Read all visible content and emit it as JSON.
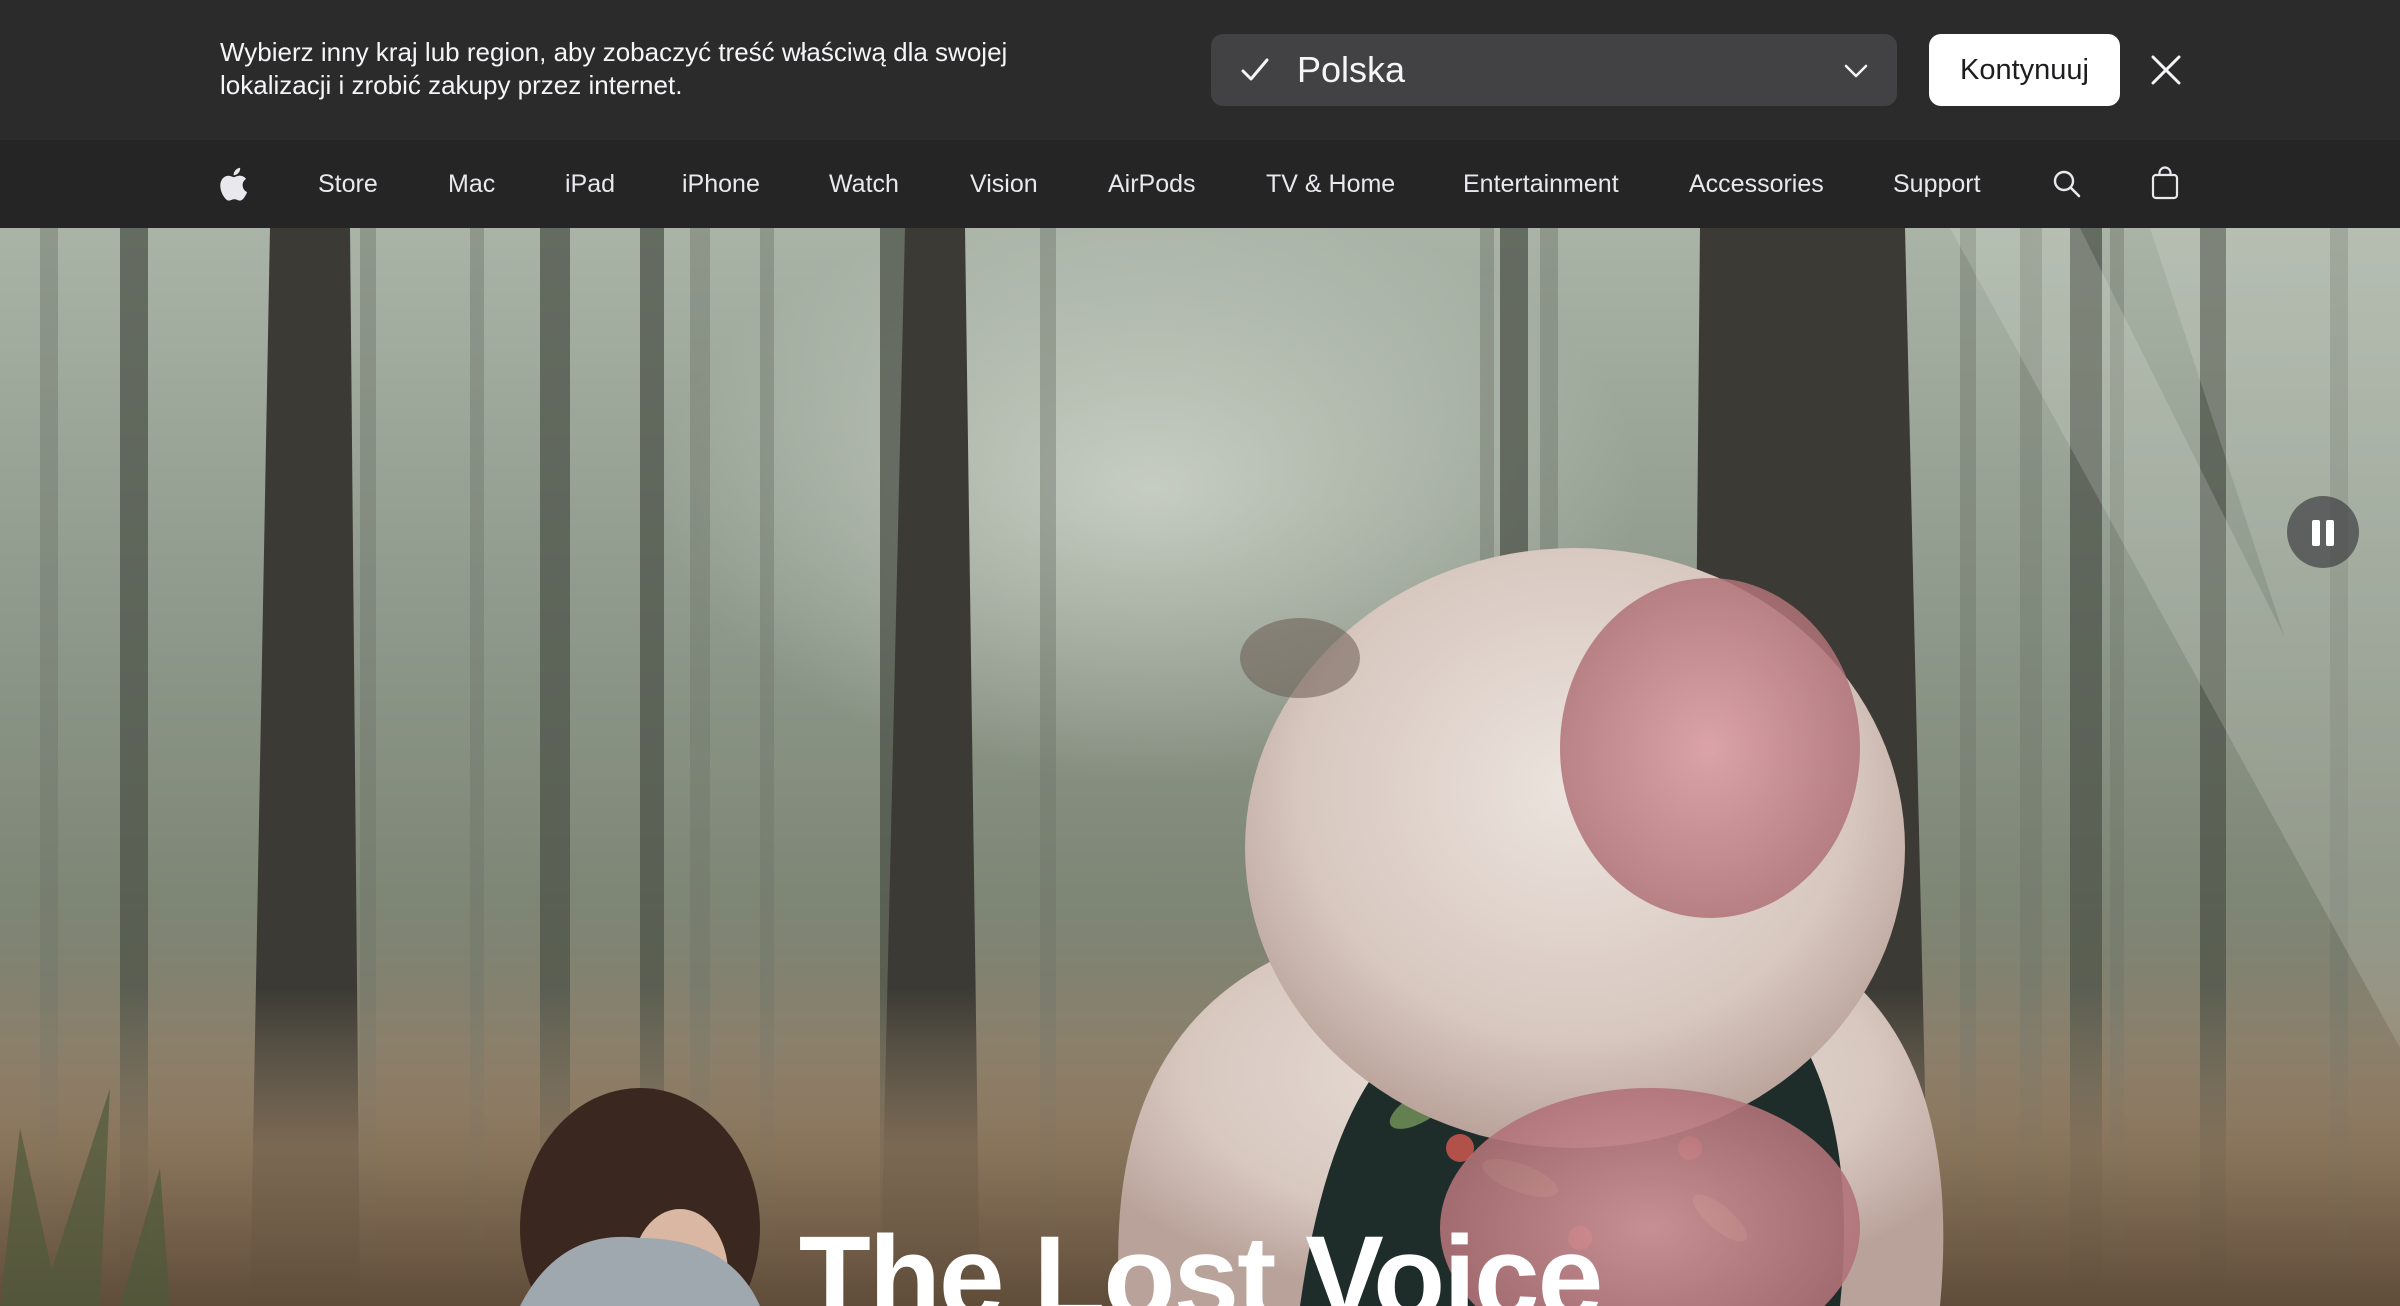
{
  "locale_banner": {
    "message": "Wybierz inny kraj lub region, aby zobaczyć treść właściwą dla swojej lokalizacji i zrobić zakupy przez internet.",
    "selected_region": "Polska",
    "continue_label": "Kontynuuj",
    "icons": {
      "check": "checkmark-icon",
      "dropdown": "chevron-down-icon",
      "close": "close-icon"
    }
  },
  "nav": {
    "logo": "apple-logo-icon",
    "items": [
      {
        "label": "Store"
      },
      {
        "label": "Mac"
      },
      {
        "label": "iPad"
      },
      {
        "label": "iPhone"
      },
      {
        "label": "Watch"
      },
      {
        "label": "Vision"
      },
      {
        "label": "AirPods"
      },
      {
        "label": "TV & Home"
      },
      {
        "label": "Entertainment"
      },
      {
        "label": "Accessories"
      },
      {
        "label": "Support"
      }
    ],
    "icons": {
      "search": "search-icon",
      "bag": "shopping-bag-icon"
    }
  },
  "hero": {
    "title": "The Lost Voice",
    "media_control": "pause-icon"
  },
  "colors": {
    "banner_bg": "#2b2b2c",
    "nav_bg": "#252525",
    "select_bg": "#424245",
    "button_bg": "#ffffff",
    "text_light": "#f5f5f7"
  }
}
